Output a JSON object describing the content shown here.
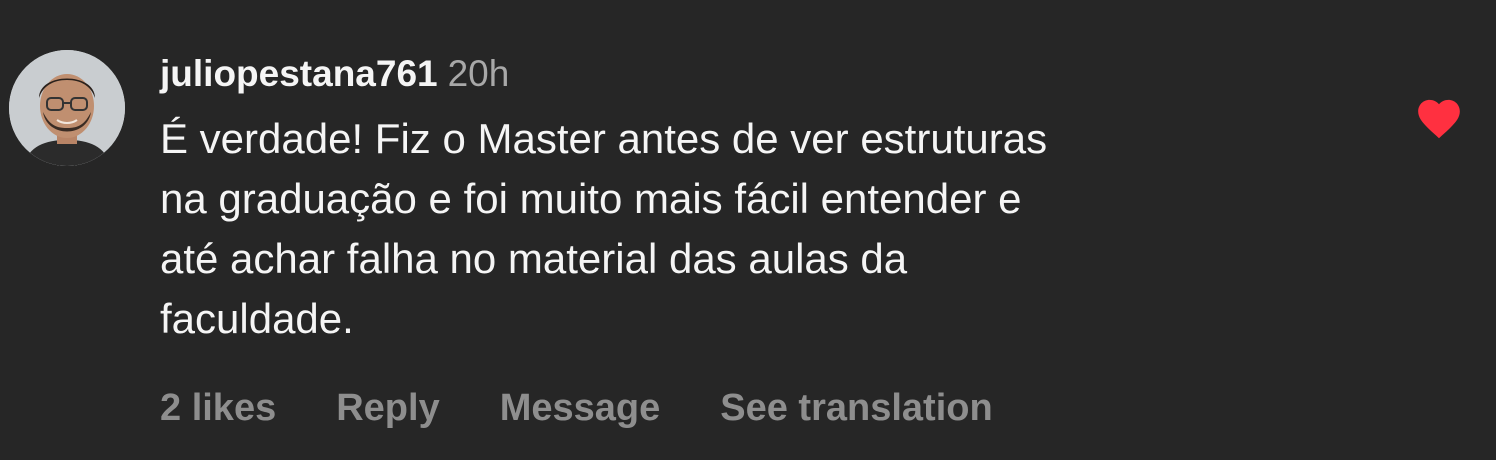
{
  "comment": {
    "username": "juliopestana761",
    "timestamp": "20h",
    "text_lines": [
      "É verdade! Fiz o Master antes de ver estruturas",
      "na graduação e foi muito mais fácil entender e",
      "até achar falha no material das aulas da",
      "faculdade."
    ],
    "liked": true,
    "like_icon": "heart-filled-icon",
    "like_color": "#ff3040"
  },
  "actions": {
    "likes": "2 likes",
    "reply": "Reply",
    "message": "Message",
    "see_translation": "See translation"
  },
  "colors": {
    "background": "#262626",
    "primary_text": "#f5f5f5",
    "secondary_text": "#a8a8a8",
    "action_text": "#8e8e8e"
  }
}
